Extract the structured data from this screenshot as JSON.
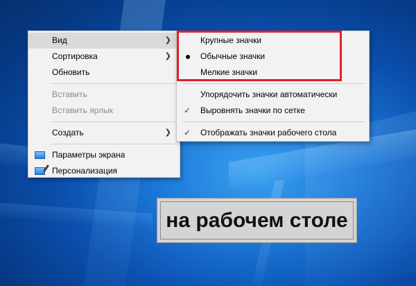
{
  "main_menu": {
    "items": [
      {
        "label": "Вид"
      },
      {
        "label": "Сортировка"
      },
      {
        "label": "Обновить"
      },
      {
        "label": "Вставить"
      },
      {
        "label": "Вставить ярлык"
      },
      {
        "label": "Создать"
      },
      {
        "label": "Параметры экрана"
      },
      {
        "label": "Персонализация"
      }
    ]
  },
  "view_submenu": {
    "items": [
      {
        "label": "Крупные значки"
      },
      {
        "label": "Обычные значки"
      },
      {
        "label": "Мелкие значки"
      },
      {
        "label": "Упорядочить значки автоматически"
      },
      {
        "label": "Выровнять значки по сетке"
      },
      {
        "label": "Отображать значки рабочего стола"
      }
    ]
  },
  "caption": {
    "text": "на рабочем столе"
  },
  "colors": {
    "highlight_border": "#e0202a",
    "menu_background": "#f2f2f2",
    "menu_hover": "#dadada",
    "desktop_blue": "#0b4fae"
  }
}
